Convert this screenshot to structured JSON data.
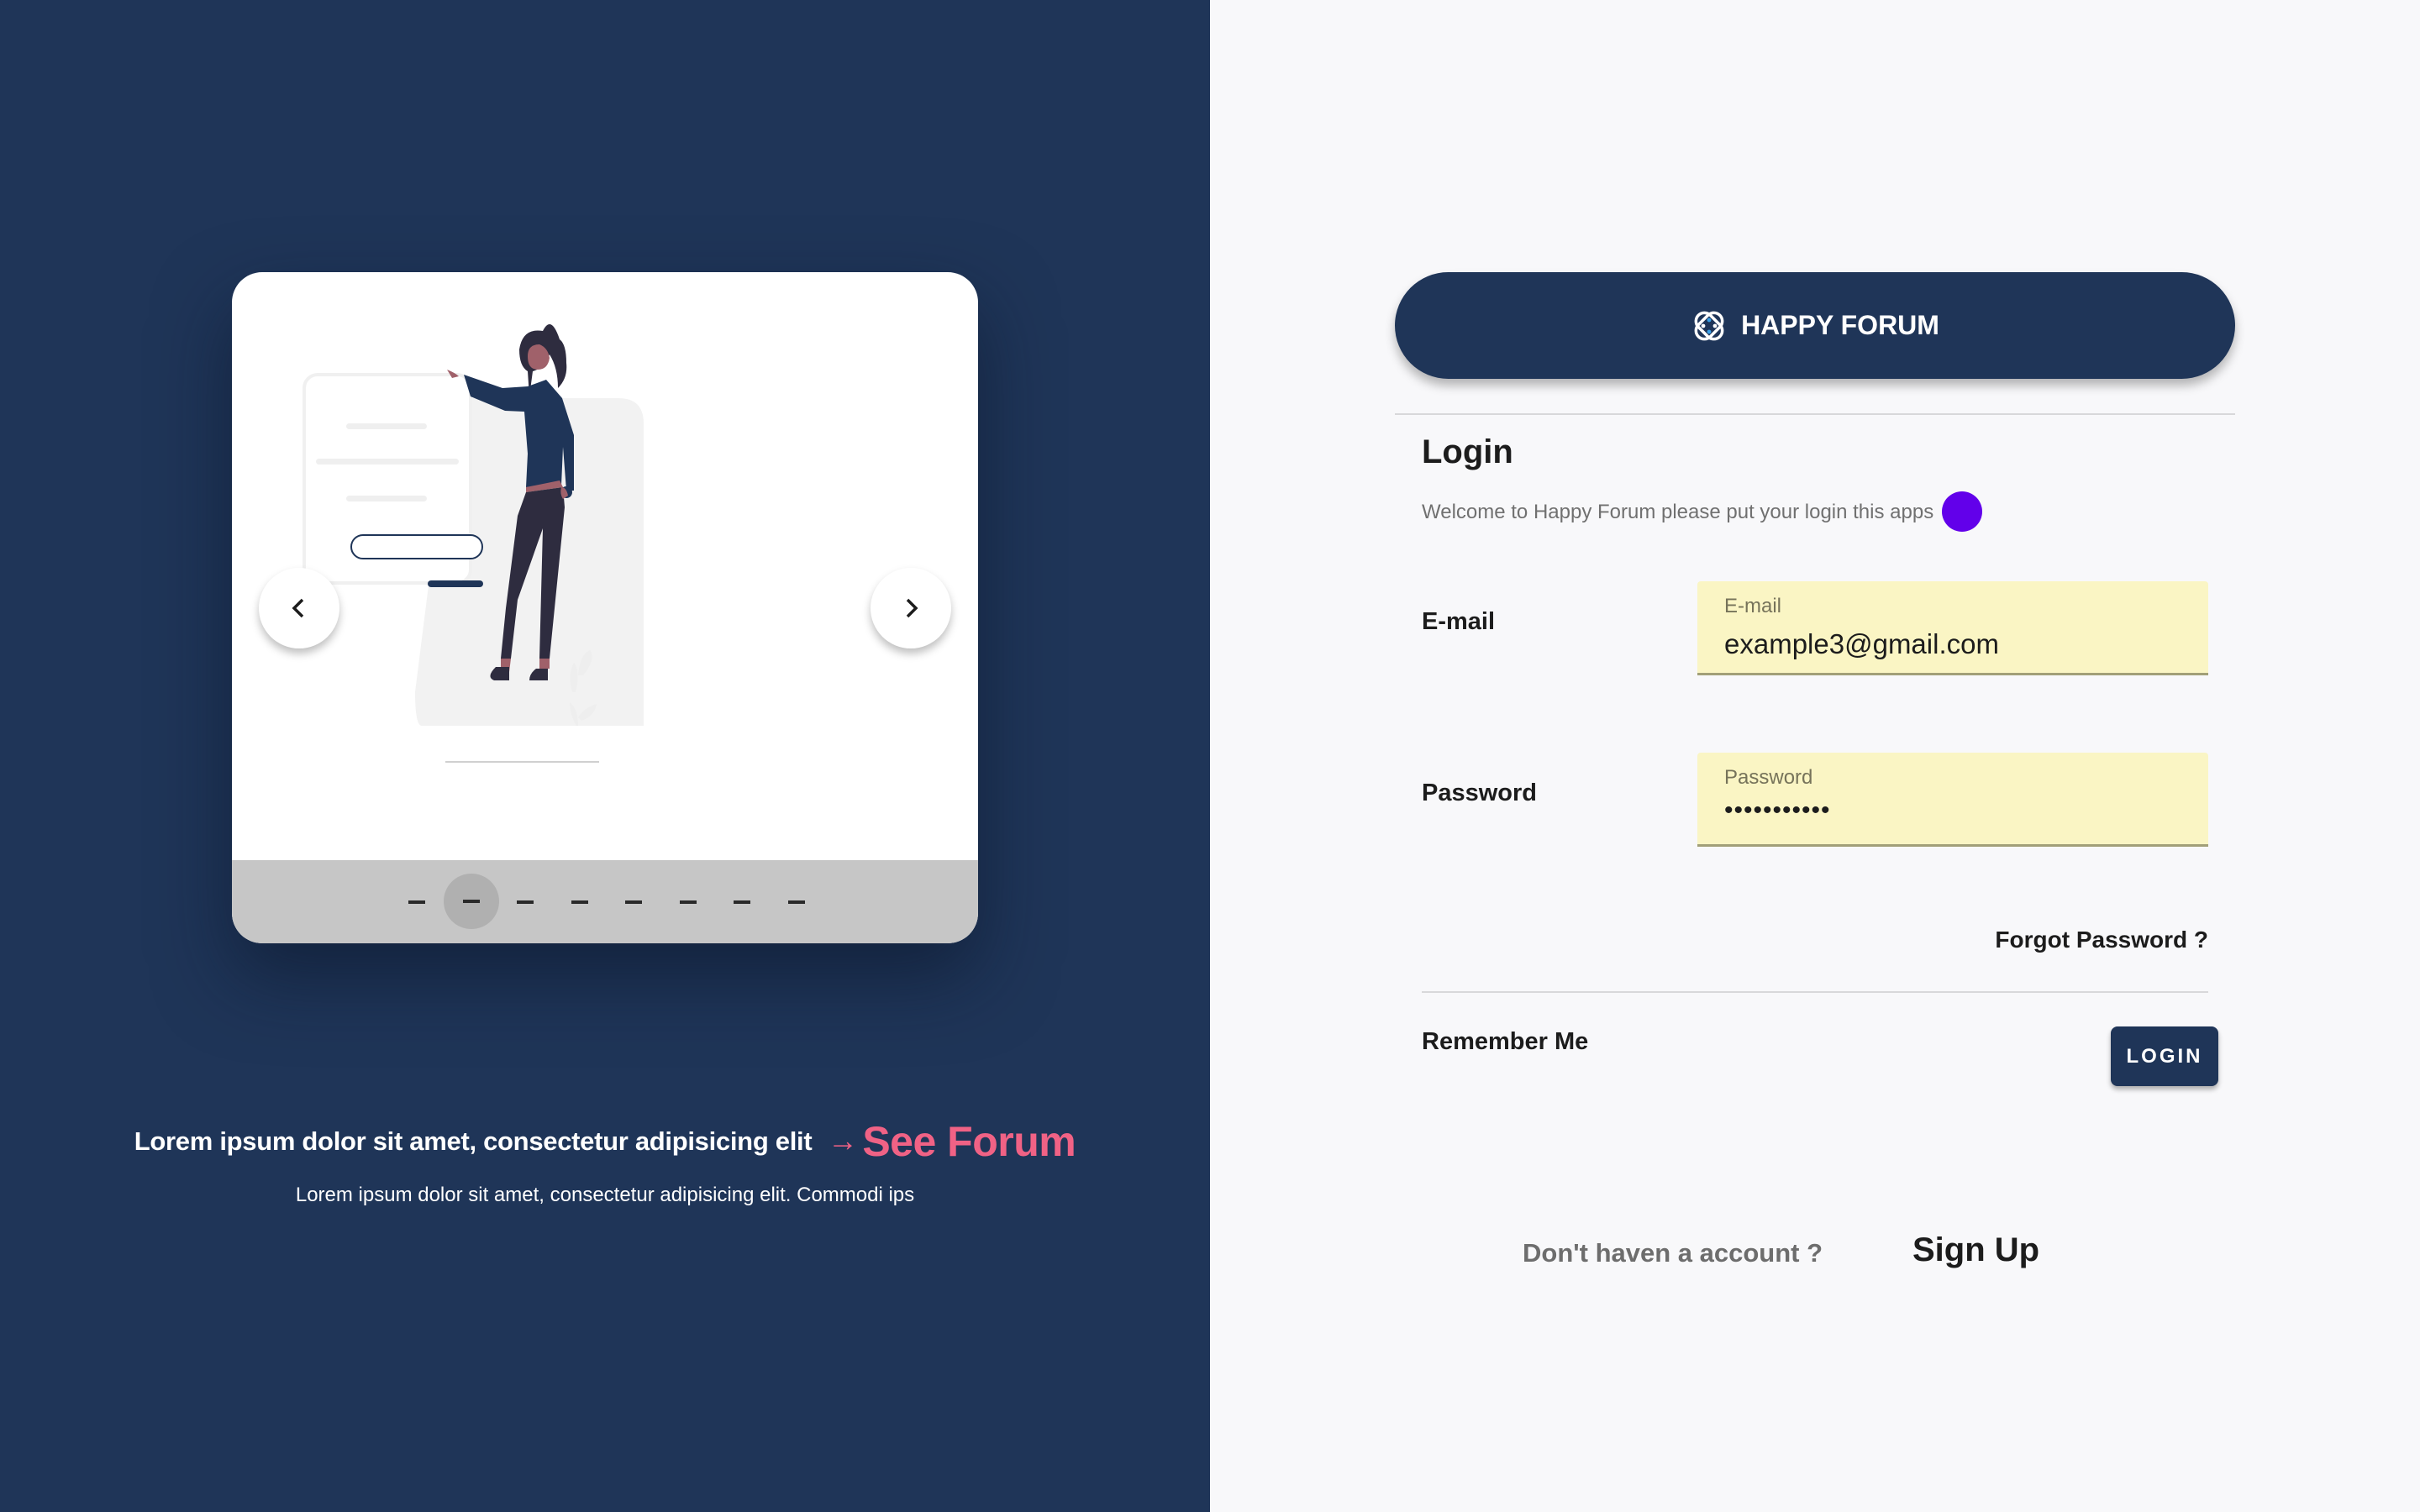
{
  "showcase": {
    "carousel": {
      "slide_count": 8,
      "active_index": 1,
      "prev_icon": "chevron-left-icon",
      "next_icon": "chevron-right-icon",
      "illustration": "woman-presenting-login-form"
    },
    "tagline": "Lorem ipsum dolor sit amet, consectetur adipisicing elit",
    "cta_arrow": "→",
    "cta_label": "See Forum",
    "subtitle": "Lorem ipsum dolor sit amet, consectetur adipisicing elit. Commodi ips"
  },
  "brand": {
    "name": "HAPPY FORUM",
    "logo_icon": "happy-forum-logo-icon"
  },
  "login": {
    "title": "Login",
    "welcome": "Welcome to Happy Forum please put your login this apps",
    "email": {
      "label": "E-mail",
      "floating_label": "E-mail",
      "value": "example3@gmail.com"
    },
    "password": {
      "label": "Password",
      "floating_label": "Password",
      "value": "•••••••••••"
    },
    "forgot_password": "Forgot Password ?",
    "remember_me": "Remember Me",
    "login_button": "LOGIN",
    "no_account": "Don't haven a account ?",
    "signup": "Sign Up"
  },
  "colors": {
    "navy": "#1f3558",
    "accent_pink": "#f06285",
    "field_bg": "#faf5c4",
    "touch_indicator": "#6200ea",
    "background": "#f8f8fa"
  }
}
